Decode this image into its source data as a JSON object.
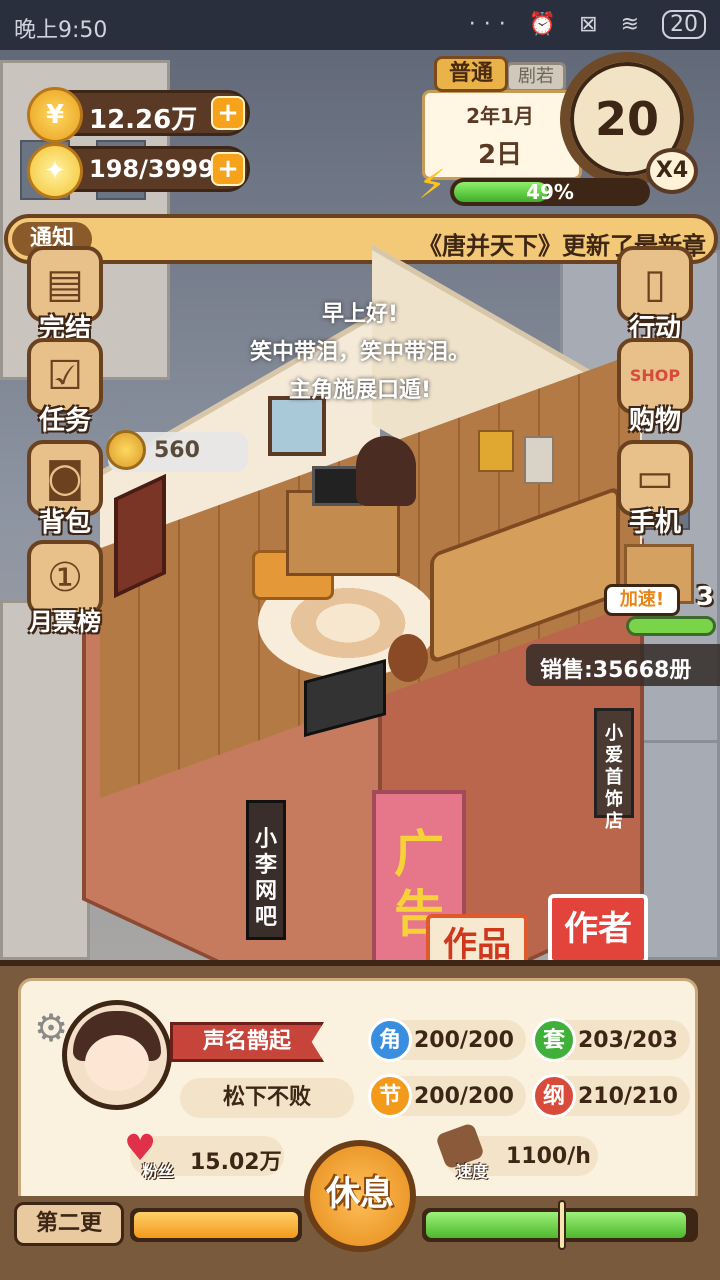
{
  "status_bar": {
    "time": "晚上9:50",
    "icons": "··· ⏰ ⊠ ≋",
    "battery": "20"
  },
  "resources": {
    "coins": "12.26万",
    "ideas": "198/3999",
    "plus": "+"
  },
  "calendar": {
    "mode": "普通",
    "mode_tab": "剧若",
    "year_month": "2年1月",
    "day": "2日",
    "clock_value": "20",
    "speed": "X4",
    "energy_percent": 49,
    "energy_label": "49%"
  },
  "notice": {
    "label": "通知",
    "message": "《唐并天下》更新了最新章"
  },
  "left_menu": [
    {
      "label": "完结",
      "icon": "book-icon"
    },
    {
      "label": "任务",
      "icon": "clipboard-icon"
    },
    {
      "label": "背包",
      "icon": "bag-icon"
    },
    {
      "label": "月票榜",
      "icon": "ticket-icon"
    }
  ],
  "right_menu": [
    {
      "label": "行动",
      "icon": "door-icon"
    },
    {
      "label": "购物",
      "icon": "shop-icon",
      "shop_text": "SHOP"
    },
    {
      "label": "手机",
      "icon": "phone-icon"
    }
  ],
  "speech": {
    "line1": "早上好!",
    "line2": "笑中带泪，笑中带泪。",
    "line3": "主角施展口遁!"
  },
  "room": {
    "coin_bubble": "560",
    "sales": "销售:35668册",
    "speedup_label": "加速!",
    "speedup_count": "3",
    "shop_sign": "小爱首饰店",
    "cafe_sign": "小李网吧",
    "ad_text": "广告"
  },
  "tabs": {
    "works": "作品",
    "author": "作者"
  },
  "author": {
    "title": "声名鹊起",
    "pen_name": "松下不败",
    "stats": [
      {
        "badge": "角",
        "value": "200/200",
        "color": "#3a8ee0"
      },
      {
        "badge": "套",
        "value": "203/203",
        "color": "#3fb03a"
      },
      {
        "badge": "节",
        "value": "200/200",
        "color": "#f39a1a"
      },
      {
        "badge": "纲",
        "value": "210/210",
        "color": "#d84a3a"
      }
    ],
    "fans_label": "粉丝",
    "fans_value": "15.02万",
    "speed_label": "速度",
    "speed_value": "1100/h"
  },
  "bottom": {
    "chapter": "第二更",
    "rest_button": "休息",
    "orange_progress": 1.0,
    "green_progress": 0.97
  }
}
